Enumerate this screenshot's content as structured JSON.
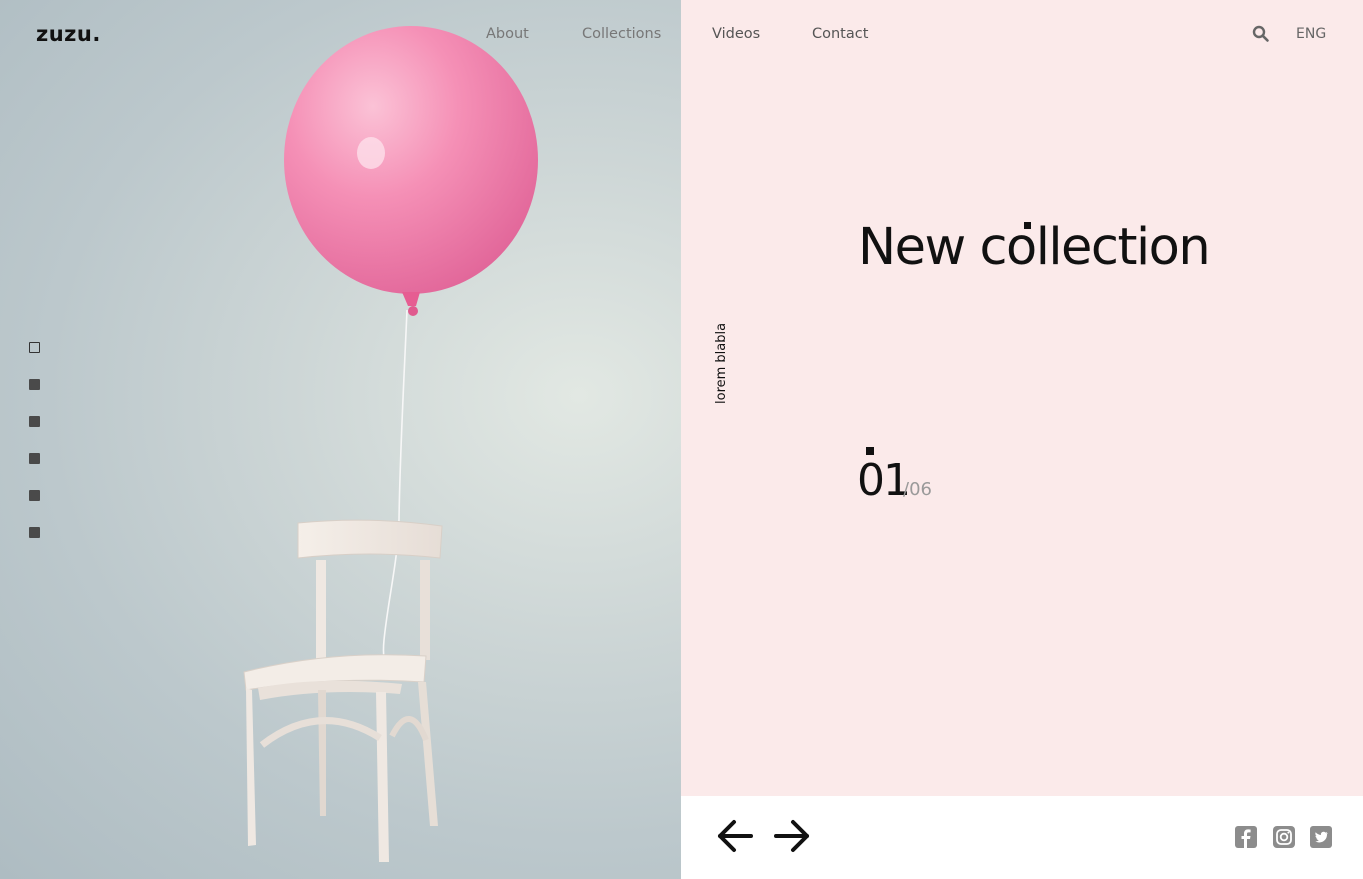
{
  "brand": {
    "logo": "zuzu."
  },
  "nav": {
    "about": "About",
    "collections": "Collections",
    "videos": "Videos",
    "contact": "Contact"
  },
  "header": {
    "language": "ENG"
  },
  "slider": {
    "side_label": "lorem blabla",
    "headline": "New collection",
    "current": "01",
    "total": "/06",
    "indicator_count": 6,
    "active_index": 0
  },
  "colors": {
    "panel_pink": "#fbeaea",
    "balloon": "#f27aa6",
    "text_dark": "#111111",
    "icon_gray": "#8c8c8c"
  },
  "icons": {
    "search": "search-icon",
    "prev": "arrow-left-icon",
    "next": "arrow-right-icon",
    "social": [
      "facebook-icon",
      "instagram-icon",
      "twitter-icon"
    ]
  }
}
